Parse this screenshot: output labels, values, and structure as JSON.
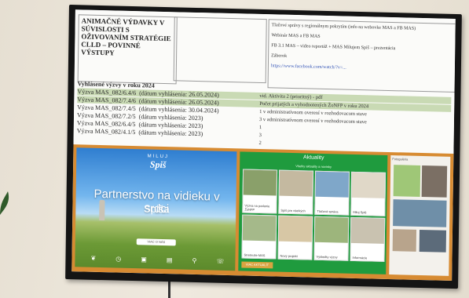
{
  "top_panel": {
    "title": "ANIMAČNÉ VÝDAVKY V SÚVISLOSTI S OŽIVOVANÍM STRATÉGIE CLLD – POVINNÉ VÝSTUPY",
    "info_lines": [
      "Tlačové správy s regionálnym pokrytím (info na webovke MAS a FB MAS)",
      "Webinár MAS a FB MAS",
      "FB 3.1 MAS – video reportáž + MAS Milujem Spiš – prezentácia",
      "Záberok",
      "https://www.facebook.com/watch/?v=..."
    ],
    "section_heading": "Vyhlásené výzvy v roku 2024",
    "rows": [
      {
        "left": "Výzva MAS_082/6.4/6",
        "date": "(dátum vyhlásenia: 26.05.2024)",
        "right": "vid. Aktivita 2 (prioritný) - pdf",
        "highlight": true
      },
      {
        "left": "Výzva MAS_082/7.4/6",
        "date": "(dátum vyhlásenia: 26.05.2024)",
        "right": "Počet prijatých a vyhodnotených ŽoNFP v roku 2024",
        "highlight": true
      },
      {
        "left": "Výzva MAS_082/7.4/5",
        "date": "(dátum vyhlásenia: 30.04.2024)",
        "right": "1 v administratívnom overení v rozhodovacom stave",
        "highlight": false
      },
      {
        "left": "Výzva MAS_082/7.2/5",
        "date": "(dátum vyhlásenia: 2023)",
        "right": "3 v administratívnom overení v rozhodovacom stave",
        "highlight": false
      },
      {
        "left": "Výzva MAS_082/6.4/5",
        "date": "(dátum vyhlásenia: 2023)",
        "right": "1",
        "highlight": false
      },
      {
        "left": "Výzva MAS_082/4.1/5",
        "date": "(dátum vyhlásenia: 2023)",
        "right": "3",
        "highlight": false
      },
      {
        "left": "",
        "date": "",
        "right": "2",
        "highlight": false
      }
    ]
  },
  "left_web": {
    "logo_small": "MILUJ",
    "logo_main": "Spiš",
    "headline": "Partnerstvo na vidieku v srdci",
    "subheadline": "Spiša",
    "button": "VIAC O NÁS",
    "icons": [
      "leaf-icon",
      "clock-icon",
      "image-icon",
      "doc-icon",
      "pin-icon",
      "phone-icon"
    ]
  },
  "middle_web": {
    "header": "Aktuality",
    "subheader": "Všetky aktuality a novinky",
    "cards": [
      "Výzva na podanie ŽoNFP",
      "Spiš pre všetkých",
      "Tlačová správa",
      "Miluj Spiš",
      "Stretnutie MAS",
      "Nový projekt",
      "Výsledky výzvy",
      "Informácie"
    ],
    "footer_button": "VIAC AKTUALÍT"
  },
  "right_web": {
    "top_text": "Fotogaléria"
  },
  "colors": {
    "frame": "#141414",
    "highlight": "#c9dab4",
    "orange": "#d78b32",
    "green": "#1f9b3e"
  }
}
